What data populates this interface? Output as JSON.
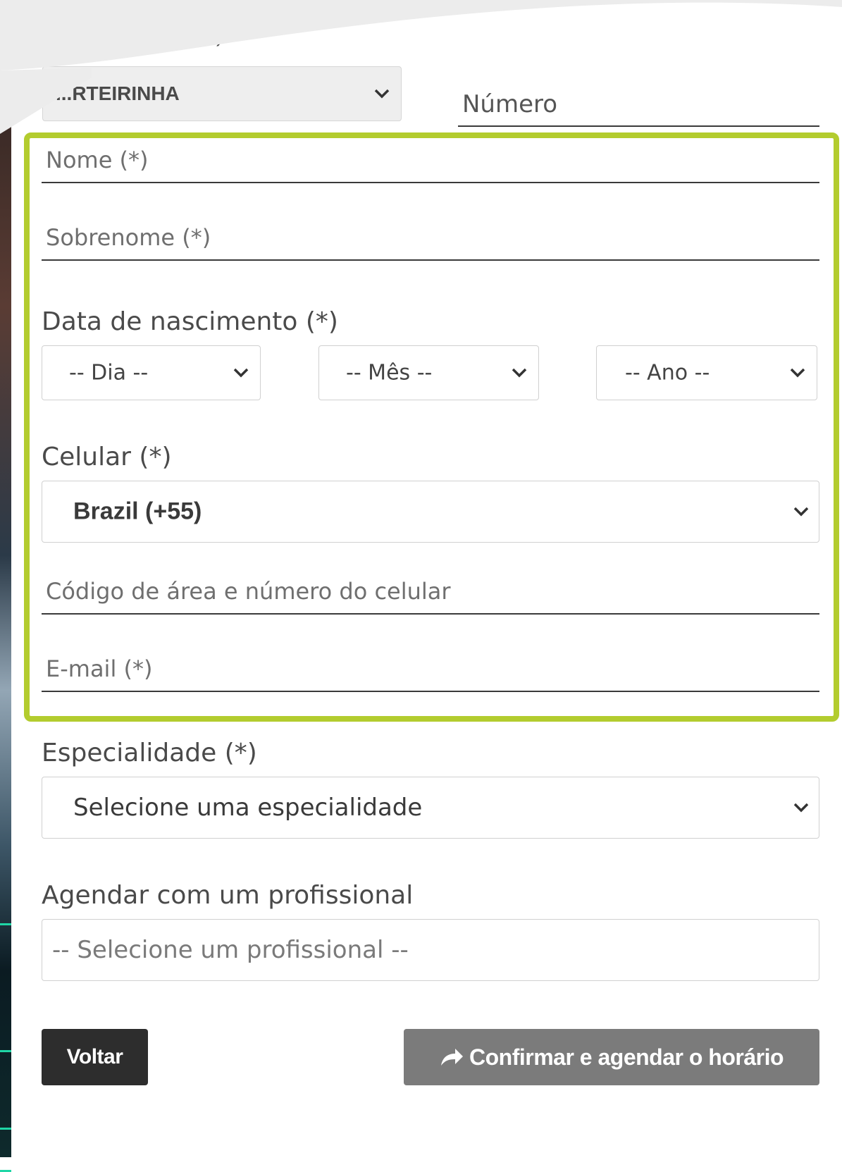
{
  "document_type": {
    "label_partial": "(*)",
    "select_value": "...RTEIRINHA"
  },
  "numero": {
    "placeholder": "Número"
  },
  "nome": {
    "placeholder": "Nome (*)"
  },
  "sobrenome": {
    "placeholder": "Sobrenome (*)"
  },
  "birthdate": {
    "label": "Data de nascimento (*)",
    "day": "-- Dia --",
    "month": "-- Mês --",
    "year": "-- Ano --"
  },
  "celular": {
    "label": "Celular (*)",
    "country": "Brazil (+55)",
    "number_placeholder": "Código de área e número do celular"
  },
  "email": {
    "placeholder": "E-mail (*)"
  },
  "especialidade": {
    "label": "Especialidade (*)",
    "value": "Selecione uma especialidade"
  },
  "profissional": {
    "label": "Agendar com um profissional",
    "placeholder": "-- Selecione um profissional --"
  },
  "buttons": {
    "back": "Voltar",
    "confirm": "Confirmar e agendar o horário"
  },
  "colors": {
    "highlight": "#b3cc2e",
    "back_button": "#2d2d2d",
    "confirm_button": "#7b7b7b"
  }
}
